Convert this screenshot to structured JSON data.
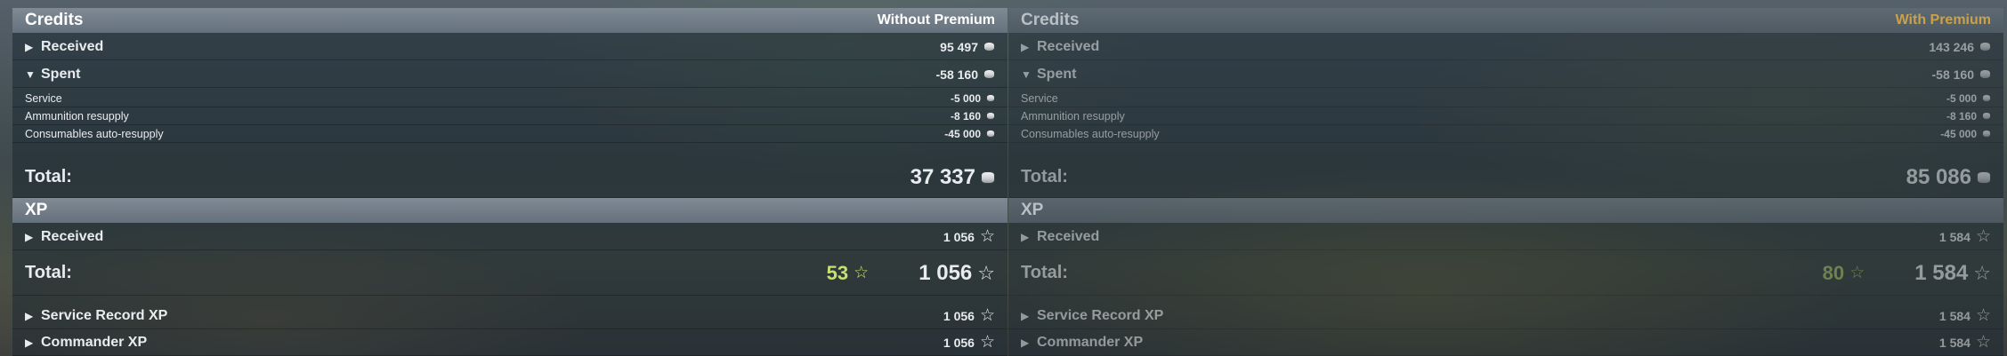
{
  "panels": [
    {
      "credits_title": "Credits",
      "mode": "Without Premium",
      "received_label": "Received",
      "received_value": "95 497",
      "spent_label": "Spent",
      "spent_value": "-58 160",
      "spent_items": [
        {
          "label": "Service",
          "value": "-5 000"
        },
        {
          "label": "Ammunition resupply",
          "value": "-8 160"
        },
        {
          "label": "Consumables auto-resupply",
          "value": "-45 000"
        }
      ],
      "total_label": "Total:",
      "total_value": "37 337",
      "xp_title": "XP",
      "xp_received_label": "Received",
      "xp_received_value": "1 056",
      "xp_total_label": "Total:",
      "xp_bonus": "53",
      "xp_total_value": "1 056",
      "service_record_label": "Service Record XP",
      "service_record_value": "1 056",
      "commander_label": "Commander XP",
      "commander_value": "1 056"
    },
    {
      "credits_title": "Credits",
      "mode": "With Premium",
      "received_label": "Received",
      "received_value": "143 246",
      "spent_label": "Spent",
      "spent_value": "-58 160",
      "spent_items": [
        {
          "label": "Service",
          "value": "-5 000"
        },
        {
          "label": "Ammunition resupply",
          "value": "-8 160"
        },
        {
          "label": "Consumables auto-resupply",
          "value": "-45 000"
        }
      ],
      "total_label": "Total:",
      "total_value": "85 086",
      "xp_title": "XP",
      "xp_received_label": "Received",
      "xp_received_value": "1 584",
      "xp_total_label": "Total:",
      "xp_bonus": "80",
      "xp_total_value": "1 584",
      "service_record_label": "Service Record XP",
      "service_record_value": "1 584",
      "commander_label": "Commander XP",
      "commander_value": "1 584"
    }
  ],
  "icons": {
    "expand": "triangle-right",
    "collapse": "triangle-down",
    "credits": "silver-coin-icon",
    "xp": "star-outline-icon"
  },
  "colors": {
    "premium_gold": "#c9a24a",
    "bonus_green": "#c8e070"
  }
}
